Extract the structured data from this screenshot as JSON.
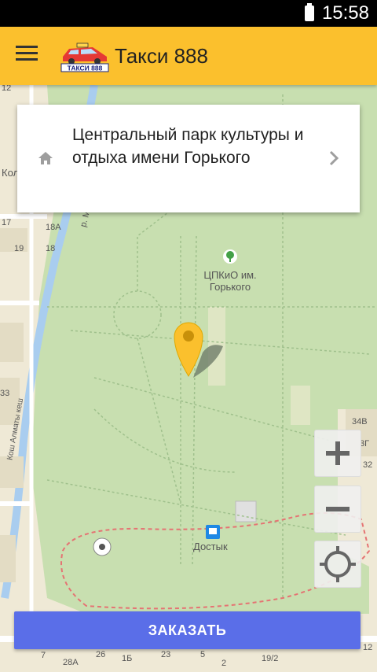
{
  "status_bar": {
    "time": "15:58"
  },
  "app_bar": {
    "title": "Такси 888",
    "logo_text": "ТАКСИ 888"
  },
  "destination_card": {
    "text": "Центральный парк культуры и отдыха имени Горького"
  },
  "map": {
    "labels": {
      "park": "ЦПКиО им. Горького",
      "metro": "Достык",
      "river": "р. М",
      "street": "Кош Алматы кеш",
      "n12": "12",
      "n17": "17",
      "n18a": "18А",
      "n18": "18",
      "n19": "19",
      "n33": "33",
      "n34v": "34В",
      "n32": "32",
      "n3g": "3Г",
      "n28a": "28А",
      "n26": "26",
      "n1b": "1Б",
      "n23": "23",
      "n5": "5",
      "n2": "2",
      "n19_2": "19/2",
      "n12b": "12",
      "n7": "7",
      "kol": "Кол"
    }
  },
  "order_button": {
    "label": "ЗАКАЗАТЬ"
  }
}
